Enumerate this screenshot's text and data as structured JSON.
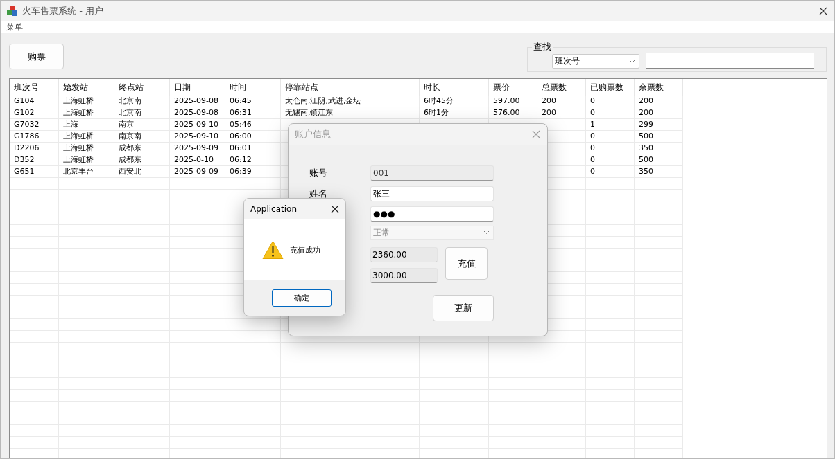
{
  "window": {
    "title": "火车售票系统 - 用户"
  },
  "menu": [
    {
      "label": "菜单"
    }
  ],
  "buy_button": "购票",
  "search": {
    "legend": "查找",
    "field_select": "班次号"
  },
  "table": {
    "columns": [
      "班次号",
      "始发站",
      "终点站",
      "日期",
      "时间",
      "停靠站点",
      "时长",
      "票价",
      "总票数",
      "已购票数",
      "余票数"
    ],
    "rows": [
      [
        "G104",
        "上海虹桥",
        "北京南",
        "2025-09-08",
        "06:45",
        "太仓南,江阴,武进,金坛",
        "6时45分",
        "597.00",
        "200",
        "0",
        "200"
      ],
      [
        "G102",
        "上海虹桥",
        "北京南",
        "2025-09-08",
        "06:31",
        "无锡南,镇江东",
        "6时1分",
        "576.00",
        "200",
        "0",
        "200"
      ],
      [
        "G7032",
        "上海",
        "南京",
        "2025-09-10",
        "05:46",
        null,
        null,
        null,
        null,
        "1",
        "299"
      ],
      [
        "G1786",
        "上海虹桥",
        "南京南",
        "2025-09-10",
        "06:00",
        null,
        null,
        null,
        null,
        "0",
        "500"
      ],
      [
        "D2206",
        "上海虹桥",
        "成都东",
        "2025-09-09",
        "06:01",
        null,
        null,
        null,
        null,
        "0",
        "350"
      ],
      [
        "D352",
        "上海虹桥",
        "成都东",
        "2025-0-10",
        "06:12",
        null,
        null,
        null,
        null,
        "0",
        "500"
      ],
      [
        "G651",
        "北京丰台",
        "西安北",
        "2025-09-09",
        "06:39",
        null,
        null,
        null,
        null,
        "0",
        "350"
      ]
    ]
  },
  "account_dialog": {
    "title": "账户信息",
    "fields": [
      {
        "label": "账号",
        "value": "001",
        "editable": false
      },
      {
        "label": "姓名",
        "value": "张三",
        "editable": true
      },
      {
        "value": "●●●",
        "editable": true
      }
    ],
    "status_select": {
      "value": "正常",
      "disabled": true
    },
    "amounts": [
      "2360.00",
      "3000.00"
    ],
    "recharge_button": "充值",
    "update_button": "更新"
  },
  "message_box": {
    "title": "Application",
    "kind": "warning",
    "message": "充值成功",
    "button": "确定",
    "button_focused": true
  }
}
